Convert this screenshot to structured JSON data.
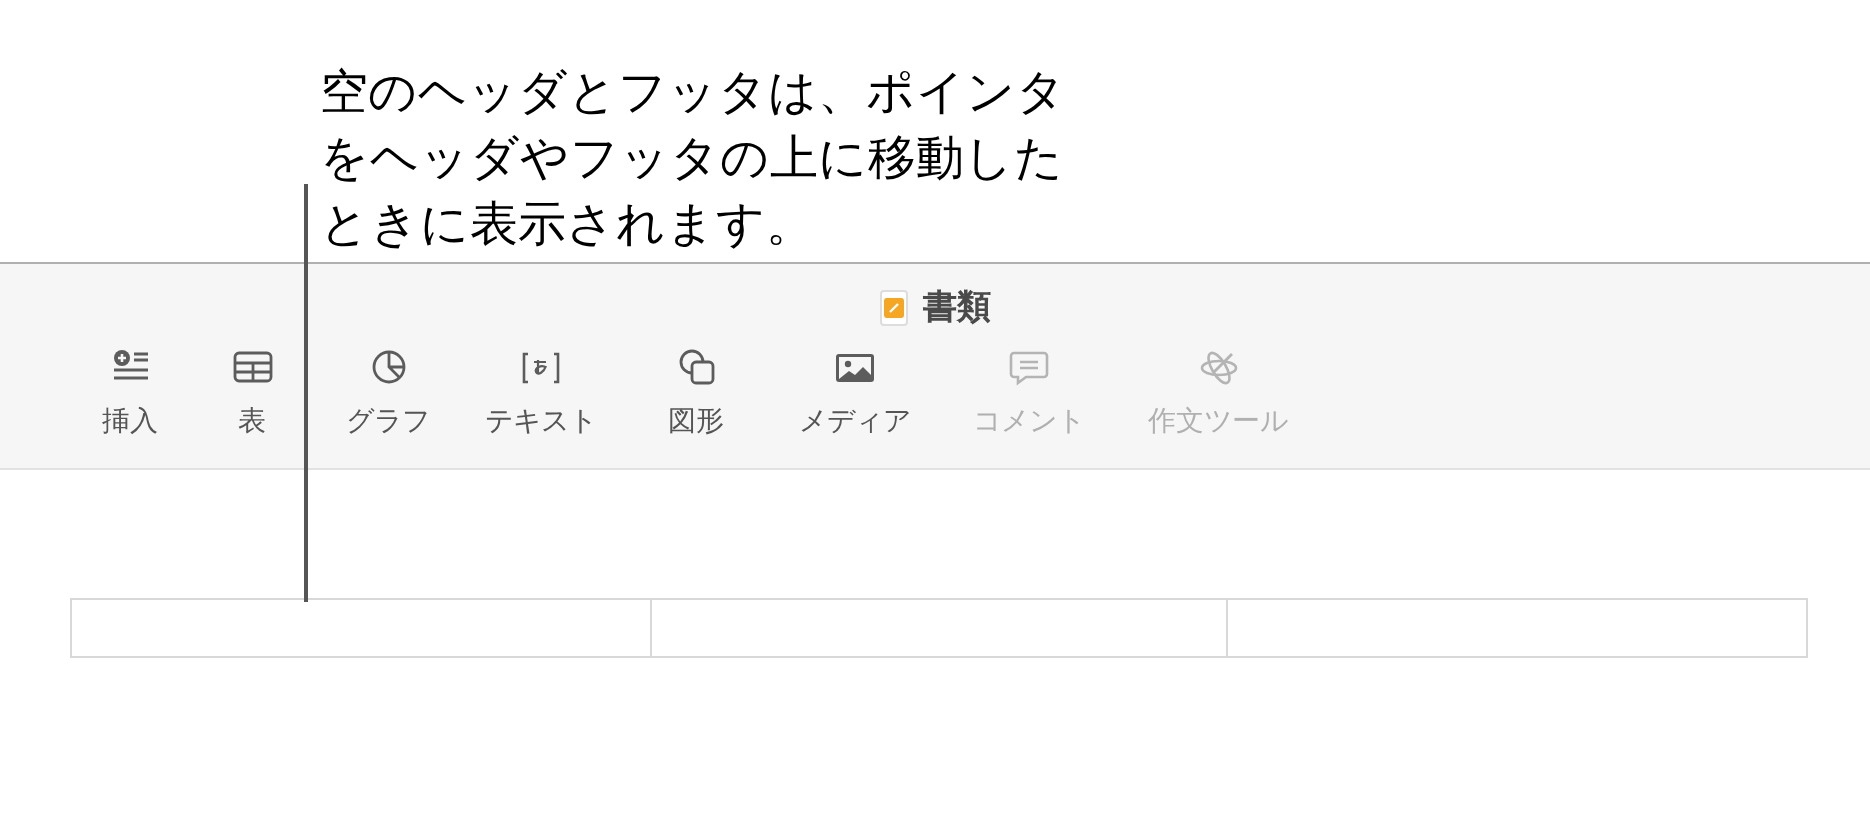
{
  "callout": {
    "lines": [
      "空のヘッダとフッタは、ポインタ",
      "をヘッダやフッタの上に移動した",
      "ときに表示されます。"
    ]
  },
  "window": {
    "title": "書類"
  },
  "toolbar": [
    {
      "label": "挿入",
      "disabled": false
    },
    {
      "label": "表",
      "disabled": false
    },
    {
      "label": "グラフ",
      "disabled": false
    },
    {
      "label": "テキスト",
      "disabled": false
    },
    {
      "label": "図形",
      "disabled": false
    },
    {
      "label": "メディア",
      "disabled": false
    },
    {
      "label": "コメント",
      "disabled": true
    },
    {
      "label": "作文ツール",
      "disabled": true
    }
  ]
}
